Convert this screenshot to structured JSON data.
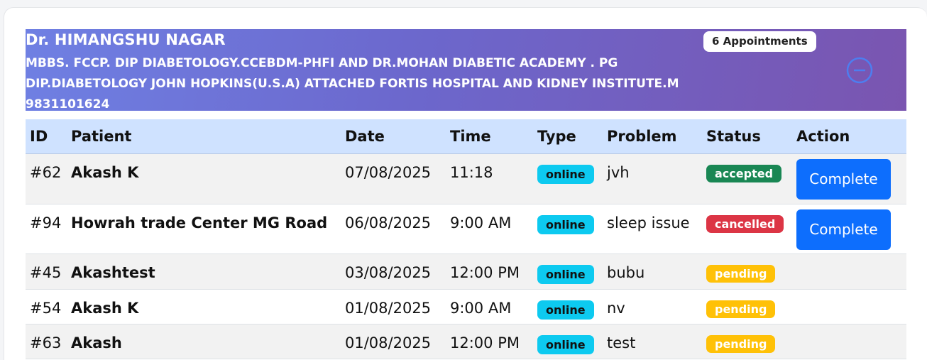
{
  "doctor": {
    "name": "Dr. HIMANGSHU NAGAR",
    "details": "MBBS. FCCP. DIP DIABETOLOGY.CCEBDM-PHFI AND DR.MOHAN DIABETIC ACADEMY . PG DIP.DIABETOLOGY JOHN HOPKINS(U.S.A) ATTACHED FORTIS HOSPITAL AND KIDNEY INSTITUTE.M 9831101624",
    "appointments_badge": "6 Appointments",
    "collapse_icon": "minus-circle-icon"
  },
  "table": {
    "headers": {
      "id": "ID",
      "patient": "Patient",
      "date": "Date",
      "time": "Time",
      "type": "Type",
      "problem": "Problem",
      "status": "Status",
      "action": "Action"
    },
    "rows": [
      {
        "id": "#62",
        "patient": "Akash K",
        "date": "07/08/2025",
        "time": "11:18",
        "type": "online",
        "problem": "jvh",
        "status": "accepted",
        "action": "Complete"
      },
      {
        "id": "#94",
        "patient": "Howrah trade Center MG Road",
        "date": "06/08/2025",
        "time": "9:00 AM",
        "type": "online",
        "problem": "sleep issue",
        "status": "cancelled",
        "action": "Complete"
      },
      {
        "id": "#45",
        "patient": "Akashtest",
        "date": "03/08/2025",
        "time": "12:00 PM",
        "type": "online",
        "problem": "bubu",
        "status": "pending",
        "action": ""
      },
      {
        "id": "#54",
        "patient": "Akash K",
        "date": "01/08/2025",
        "time": "9:00 AM",
        "type": "online",
        "problem": "nv",
        "status": "pending",
        "action": ""
      },
      {
        "id": "#63",
        "patient": "Akash",
        "date": "01/08/2025",
        "time": "12:00 PM",
        "type": "online",
        "problem": "test",
        "status": "pending",
        "action": ""
      }
    ]
  },
  "colors": {
    "header_gradient_start": "#6f80e3",
    "header_gradient_end": "#7a55b0",
    "table_head_bg": "#cfe2ff",
    "accepted": "#198754",
    "cancelled": "#dc3545",
    "pending": "#ffc107",
    "online": "#0dcaf0",
    "primary_button": "#0d6efd"
  }
}
